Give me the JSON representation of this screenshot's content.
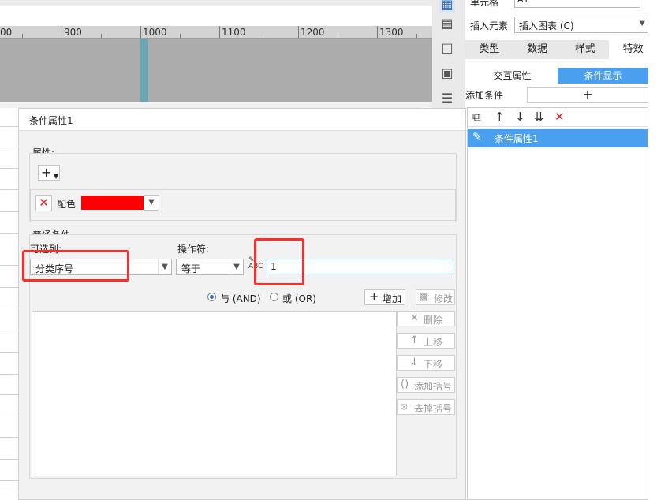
{
  "ruler": {
    "labels": [
      "00",
      "900",
      "1000",
      "1100",
      "1200",
      "1300"
    ]
  },
  "right_panel": {
    "cell_label": "单元格",
    "cell_value": "A1",
    "insert_label": "插入元素",
    "insert_value": "插入图表 (C)",
    "tabs": [
      "类型",
      "数据",
      "样式",
      "特效"
    ],
    "active_tab": "特效",
    "subtabs": [
      "交互属性",
      "条件显示"
    ],
    "active_subtab": "条件显示",
    "add_condition_label": "添加条件",
    "add_icon": "+",
    "conditions": [
      "条件属性1"
    ],
    "toolbar_icons": [
      "copy-icon",
      "arrow-up-icon",
      "arrow-down-icon",
      "move-bottom-icon",
      "delete-icon"
    ]
  },
  "dialog": {
    "title": "条件属性1",
    "attr_group_title": "属性:",
    "add_attr_glyph": "+",
    "attr_name": "配色",
    "attr_color": "#ff0000",
    "common_group_title": "普通条件",
    "column_label": "可选列:",
    "column_value": "分类序号",
    "operator_label": "操作符:",
    "operator_value": "等于",
    "value_input": "1",
    "and_label": "与 (AND)",
    "or_label": "或 (OR)",
    "logic_selected": "and",
    "add_button": "增加",
    "modify_button": "修改",
    "side_buttons": [
      "删除",
      "上移",
      "下移",
      "添加括号",
      "去掉括号"
    ]
  },
  "highlight_color": "#ff2a2a",
  "accent_color": "#4aa0ef"
}
